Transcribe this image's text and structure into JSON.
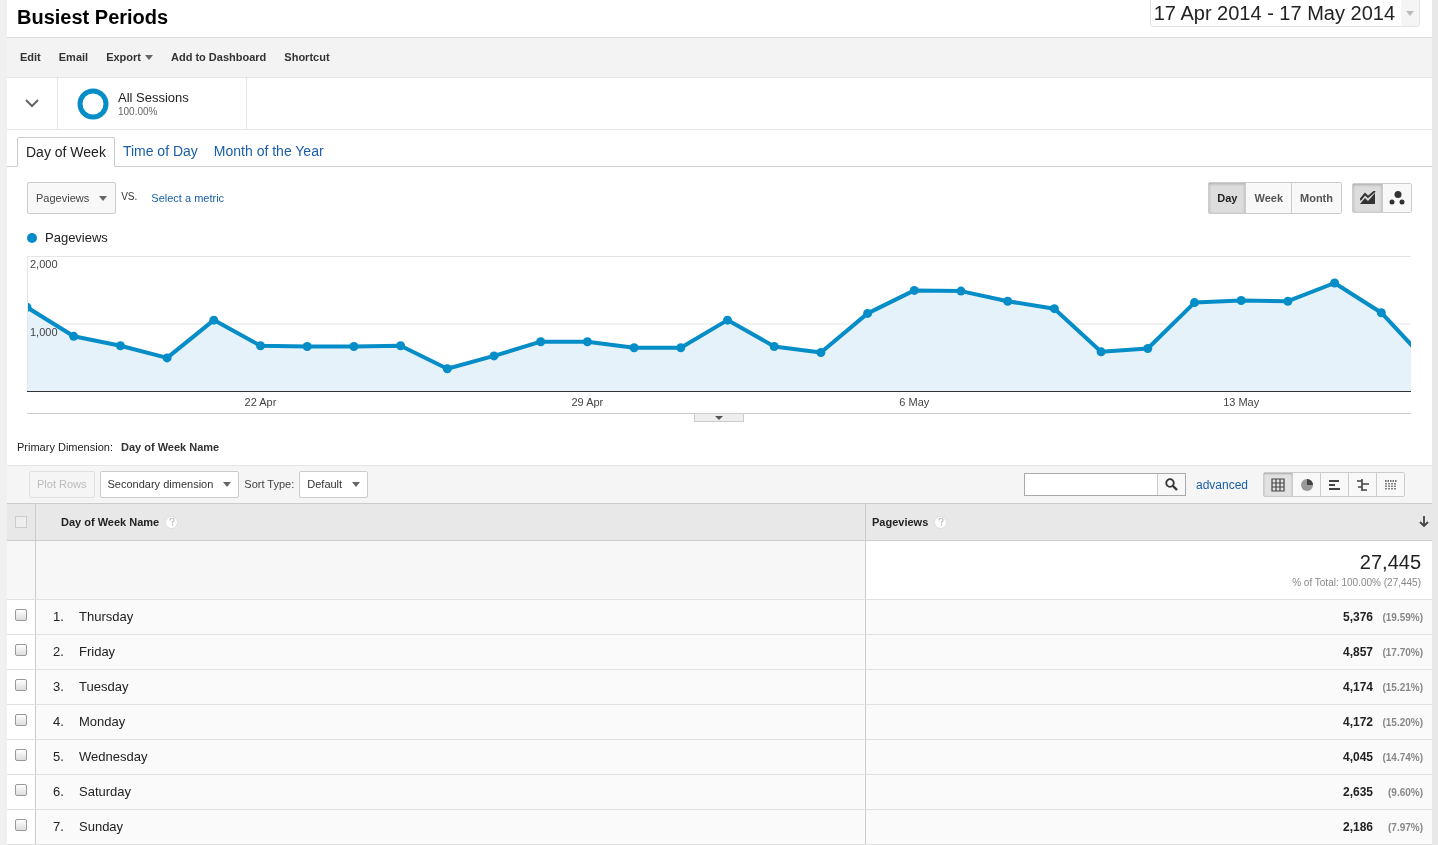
{
  "title": "Busiest Periods",
  "date_range": "17 Apr 2014 - 17 May 2014",
  "toolbar": [
    {
      "label": "Edit",
      "dropdown": false
    },
    {
      "label": "Email",
      "dropdown": false
    },
    {
      "label": "Export",
      "dropdown": true
    },
    {
      "label": "Add to Dashboard",
      "dropdown": false
    },
    {
      "label": "Shortcut",
      "dropdown": false
    }
  ],
  "segment": {
    "name": "All Sessions",
    "percent": "100.00%"
  },
  "tabs": [
    {
      "label": "Day of Week",
      "selected": true
    },
    {
      "label": "Time of Day",
      "selected": false
    },
    {
      "label": "Month of the Year",
      "selected": false
    }
  ],
  "metric_selector": {
    "metric": "Pageviews",
    "vs": "VS.",
    "compare": "Select a metric"
  },
  "period_buttons": [
    {
      "label": "Day",
      "selected": true
    },
    {
      "label": "Week",
      "selected": false
    },
    {
      "label": "Month",
      "selected": false
    }
  ],
  "chart_type_buttons": [
    {
      "kind": "line",
      "selected": true
    },
    {
      "kind": "motion",
      "selected": false
    }
  ],
  "chart": {
    "chart_data": {
      "type": "area",
      "categories": [
        null,
        null,
        null,
        null,
        null,
        "22 Apr",
        null,
        null,
        null,
        null,
        null,
        null,
        "29 Apr",
        null,
        null,
        null,
        null,
        null,
        null,
        "6 May",
        null,
        null,
        null,
        null,
        null,
        null,
        "13 May",
        null,
        null,
        null,
        null
      ],
      "series": [
        {
          "name": "Pageviews",
          "color": "#058dc7",
          "values": [
            1240,
            810,
            670,
            490,
            1050,
            670,
            660,
            660,
            670,
            330,
            520,
            730,
            730,
            640,
            640,
            1050,
            660,
            570,
            1150,
            1490,
            1480,
            1330,
            1220,
            580,
            630,
            1310,
            1340,
            1330,
            1600,
            1160,
            420
          ]
        }
      ],
      "ylim": [
        0,
        2000
      ],
      "yticks": [
        {
          "value": 1000,
          "label": "1,000"
        },
        {
          "value": 2000,
          "label": "2,000"
        }
      ]
    }
  },
  "primary_dimension": {
    "label": "Primary Dimension:",
    "value": "Day of Week Name"
  },
  "table_controls": {
    "plot_rows": {
      "label": "Plot Rows",
      "disabled": true
    },
    "secondary": "Secondary dimension",
    "sort_label": "Sort Type:",
    "sort": "Default",
    "advanced": "advanced"
  },
  "view_buttons": [
    {
      "kind": "table",
      "selected": true
    },
    {
      "kind": "pie",
      "selected": false
    },
    {
      "kind": "bars",
      "selected": false
    },
    {
      "kind": "compare",
      "selected": false
    },
    {
      "kind": "pivot",
      "selected": false
    }
  ],
  "table": {
    "select_all": {
      "checked": false
    },
    "columns": [
      {
        "label": "Day of Week Name",
        "sorted": false
      },
      {
        "label": "Pageviews",
        "sorted": true
      }
    ],
    "totals": {
      "value": "27,445",
      "share": "% of Total: 100.00% (27,445)"
    },
    "rows": [
      {
        "rank": "1.",
        "name": "Thursday",
        "value": "5,376",
        "share": "(19.59%)",
        "checked": false
      },
      {
        "rank": "2.",
        "name": "Friday",
        "value": "4,857",
        "share": "(17.70%)",
        "checked": false
      },
      {
        "rank": "3.",
        "name": "Tuesday",
        "value": "4,174",
        "share": "(15.21%)",
        "checked": false
      },
      {
        "rank": "4.",
        "name": "Monday",
        "value": "4,172",
        "share": "(15.20%)",
        "checked": false
      },
      {
        "rank": "5.",
        "name": "Wednesday",
        "value": "4,045",
        "share": "(14.74%)",
        "checked": false
      },
      {
        "rank": "6.",
        "name": "Saturday",
        "value": "2,635",
        "share": "(9.60%)",
        "checked": false
      },
      {
        "rank": "7.",
        "name": "Sunday",
        "value": "2,186",
        "share": "(7.97%)",
        "checked": false
      }
    ]
  }
}
